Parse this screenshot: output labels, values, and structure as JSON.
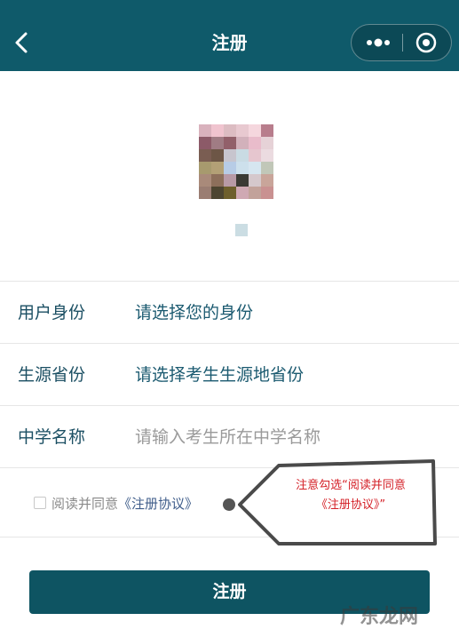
{
  "nav": {
    "title": "注册",
    "back_icon": "back-arrow-icon",
    "more_icon": "more-dots-icon",
    "home_icon": "target-circle-icon",
    "bar_color": "#0f5a6a"
  },
  "form": {
    "rows": [
      {
        "label": "用户身份",
        "value": "请选择您的身份"
      },
      {
        "label": "生源省份",
        "value": "请选择考生生源地省份"
      },
      {
        "label": "中学名称",
        "placeholder": "请输入考生所在中学名称"
      }
    ]
  },
  "agreement": {
    "prefix": "阅读并同意",
    "link": "《注册协议》",
    "checked": false
  },
  "callout": {
    "line1": "注意勾选“阅读并同意",
    "line2": "《注册协议》”",
    "text_color": "#d41f26"
  },
  "button": {
    "label": "注册",
    "color": "#0e5462"
  },
  "watermark": "广东龙网"
}
